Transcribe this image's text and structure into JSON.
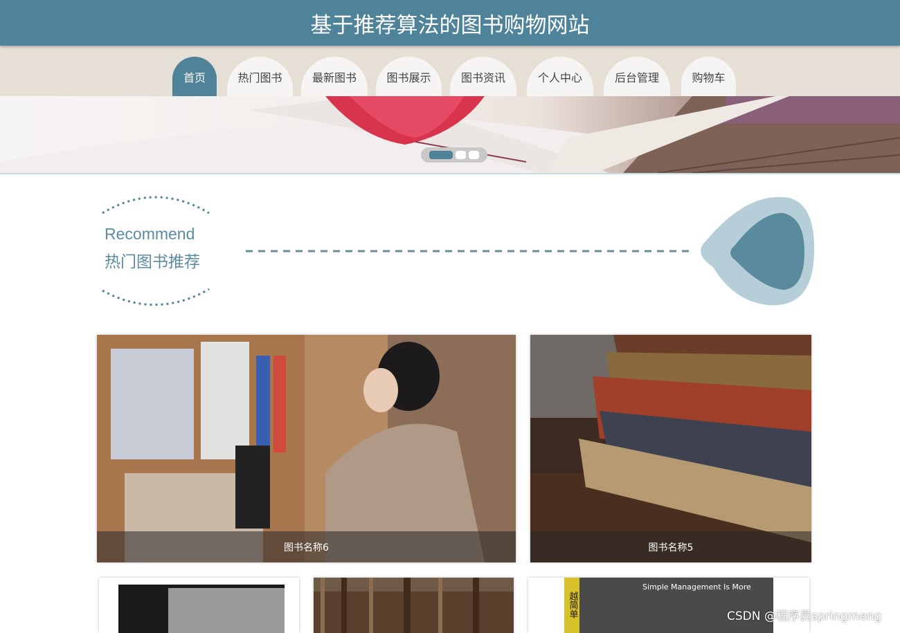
{
  "header": {
    "title": "基于推荐算法的图书购物网站"
  },
  "nav": {
    "items": [
      {
        "label": "首页",
        "active": true
      },
      {
        "label": "热门图书"
      },
      {
        "label": "最新图书"
      },
      {
        "label": "图书展示"
      },
      {
        "label": "图书资讯"
      },
      {
        "label": "个人中心"
      },
      {
        "label": "后台管理"
      },
      {
        "label": "购物车"
      }
    ]
  },
  "carousel": {
    "slide_count": 3,
    "active_index": 0
  },
  "section": {
    "title_en": "Recommend",
    "title_cn": "热门图书推荐"
  },
  "books": [
    {
      "name": "图书名称6"
    },
    {
      "name": "图书名称5"
    }
  ],
  "small_cards": {
    "cover_text_main": "Simple Management Is More",
    "cover_text_cn": "越简单"
  },
  "watermark": "CSDN @程序员springmeng",
  "colors": {
    "primary": "#4f8399",
    "nav_bg": "#e6dfd6",
    "accent_light": "#b6ced8"
  }
}
